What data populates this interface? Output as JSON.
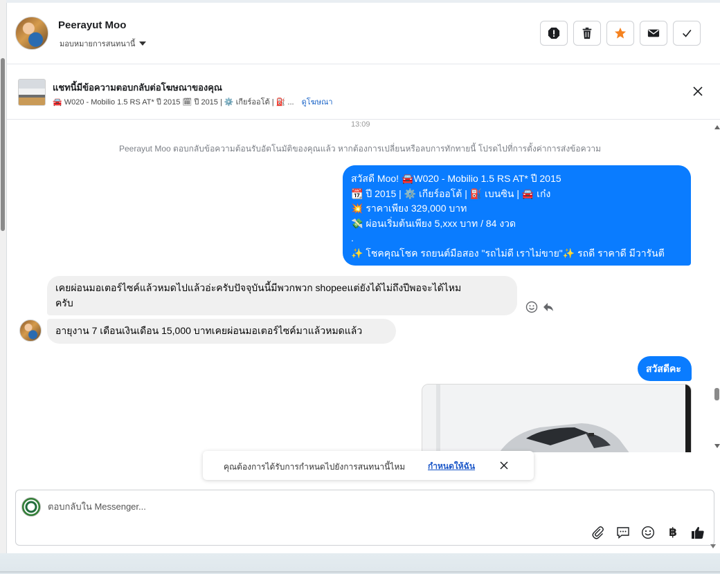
{
  "header": {
    "contact_name": "Peerayut Moo",
    "assign_label": "มอบหมายการสนทนานี้",
    "buttons": {
      "spam": "spam-icon",
      "delete": "trash-icon",
      "star": "star-icon",
      "mark_unread": "envelope-icon",
      "done": "check-icon"
    },
    "star_color": "#f5821f"
  },
  "ad_banner": {
    "title": "แชทนี้มีข้อความตอบกลับต่อโฆษณาของคุณ",
    "subtitle": "🚘 W020 - Mobilio 1.5 RS AT* ปี 2015 🗓 ปี 2015 | ⚙️ เกียร์ออโต้ | ⛽ ...",
    "link_label": "ดูโฆษณา"
  },
  "chat": {
    "timestamp": "13:09",
    "system_notice": "Peerayut Moo ตอบกลับข้อความต้อนรับอัตโนมัติของคุณแล้ว หากต้องการเปลี่ยนหรือลบการทักทายนี้ โปรดไปที่การตั้งค่าการส่งข้อความ",
    "outgoing_greeting_lines": [
      "สวัสดี Moo! 🚘W020 - Mobilio 1.5 RS AT* ปี 2015",
      "📆 ปี 2015 | ⚙️ เกียร์ออโต้ | ⛽ เบนซิน | 🚘 เก๋ง",
      "💥 ราคาเพียง 329,000 บาท",
      "💸 ผ่อนเริ่มต้นเพียง 5,xxx บาท / 84 งวด",
      ".",
      "✨ โชคคุณโชค รถยนต์มือสอง \"รถไม่ดี เราไม่ขาย\"✨ รถดี ราคาดี มีวารันตี"
    ],
    "incoming_1_lines": [
      "เคยผ่อนมอเตอร์ไซค์แล้วหมดไปแล้วอ่ะครับปัจจุบันนี้มีพวกพวก shopeeแต่ยังได้ไม่ถึงปีพอจะได้ไหม",
      "ครับ"
    ],
    "incoming_2": "อายุงาน 7 เดือนเงินเดือน 15,000 บาทเคยผ่อนมอเตอร์ไซค์มาแล้วหมดแล้ว",
    "outgoing_short": "สวัสดีคะ",
    "outgoing_bubble_color": "#0a7cff"
  },
  "toast": {
    "text": "คุณต้องการได้รับการกำหนดไปยังการสนทนานี้ไหม",
    "link_label": "กำหนดให้ฉัน"
  },
  "composer": {
    "placeholder": "ตอบกลับใน Messenger...",
    "tools": [
      "paperclip-icon",
      "saved-reply-icon",
      "emoji-icon",
      "baht-icon",
      "thumbs-up-icon"
    ],
    "baht_symbol": "฿"
  }
}
